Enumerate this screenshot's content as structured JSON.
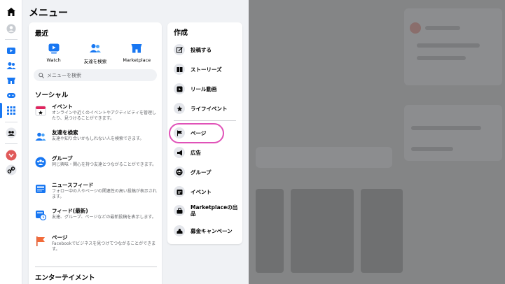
{
  "menu": {
    "title": "メニュー",
    "recent_title": "最近",
    "recent": [
      {
        "label": "Watch",
        "icon": "watch-icon"
      },
      {
        "label": "友達を検索",
        "icon": "friends-icon"
      },
      {
        "label": "Marketplace",
        "icon": "marketplace-icon"
      }
    ],
    "search": {
      "placeholder": "メニューを検索"
    },
    "social_title": "ソーシャル",
    "social": [
      {
        "title": "イベント",
        "desc": "オンラインや近くのイベントやアクティビティを管理したり、見つけることができます。",
        "icon": "calendar-icon"
      },
      {
        "title": "友達を検索",
        "desc": "友達や知り合いかもしれない人を検索できます。",
        "icon": "friends-icon"
      },
      {
        "title": "グループ",
        "desc": "同じ興味・関心を持つ友達とつながることができます。",
        "icon": "groups-icon"
      },
      {
        "title": "ニュースフィード",
        "desc": "フォロー中の人やページの関連性の高い投稿が表示されます。",
        "icon": "news-feed-icon"
      },
      {
        "title": "フィード(最新)",
        "desc": "友達、グループ、ページなどの最新投稿を表示します。",
        "icon": "recent-feed-icon"
      },
      {
        "title": "ページ",
        "desc": "Facebookでビジネスを見つけてつながることができます。",
        "icon": "page-flag-icon"
      }
    ],
    "entertainment_title": "エンターテイメント"
  },
  "create": {
    "title": "作成",
    "items": [
      {
        "label": "投稿する",
        "icon": "compose-icon"
      },
      {
        "label": "ストーリーズ",
        "icon": "book-icon"
      },
      {
        "label": "リール動画",
        "icon": "reel-icon"
      },
      {
        "label": "ライフイベント",
        "icon": "star-icon"
      },
      {
        "label": "ページ",
        "icon": "flag-icon"
      },
      {
        "label": "広告",
        "icon": "megaphone-icon"
      },
      {
        "label": "グループ",
        "icon": "groups-icon"
      },
      {
        "label": "イベント",
        "icon": "event-icon"
      },
      {
        "label": "Marketplaceの出品",
        "icon": "bag-icon"
      },
      {
        "label": "募金キャンペーン",
        "icon": "fundraiser-icon"
      }
    ]
  },
  "colors": {
    "accent": "#1877f2",
    "highlight": "#e052b8",
    "background": "#f0f2f5"
  }
}
